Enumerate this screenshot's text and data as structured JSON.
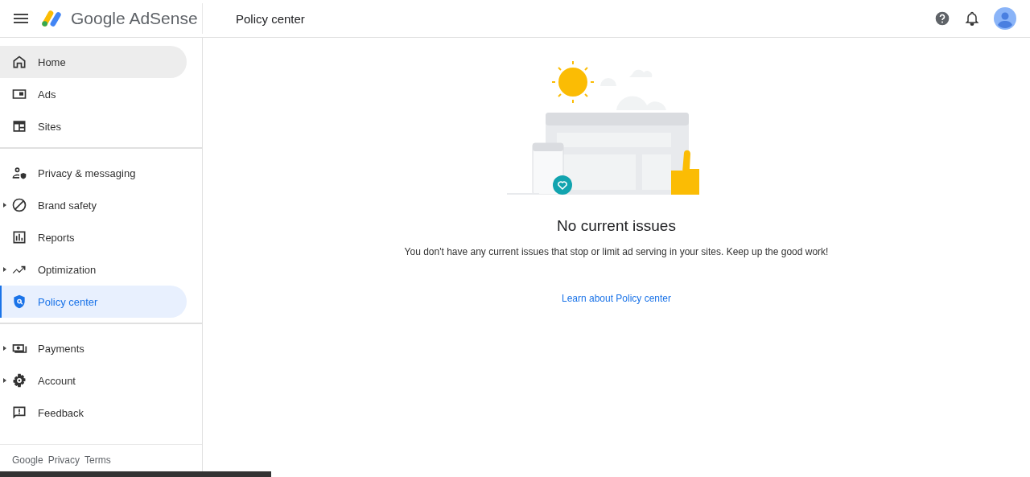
{
  "header": {
    "product": "Google AdSense",
    "page_title": "Policy center"
  },
  "sidebar": {
    "sections": [
      [
        {
          "label": "Home",
          "expandable": false,
          "selected": false,
          "hovered": true
        },
        {
          "label": "Ads",
          "expandable": false,
          "selected": false,
          "hovered": false
        },
        {
          "label": "Sites",
          "expandable": false,
          "selected": false,
          "hovered": false
        }
      ],
      [
        {
          "label": "Privacy & messaging",
          "expandable": false,
          "selected": false,
          "hovered": false
        },
        {
          "label": "Brand safety",
          "expandable": true,
          "selected": false,
          "hovered": false
        },
        {
          "label": "Reports",
          "expandable": false,
          "selected": false,
          "hovered": false
        },
        {
          "label": "Optimization",
          "expandable": true,
          "selected": false,
          "hovered": false
        },
        {
          "label": "Policy center",
          "expandable": false,
          "selected": true,
          "hovered": false
        }
      ],
      [
        {
          "label": "Payments",
          "expandable": true,
          "selected": false,
          "hovered": false
        },
        {
          "label": "Account",
          "expandable": true,
          "selected": false,
          "hovered": false
        },
        {
          "label": "Feedback",
          "expandable": false,
          "selected": false,
          "hovered": false
        }
      ]
    ],
    "footer_links": [
      "Google",
      "Privacy",
      "Terms"
    ]
  },
  "main": {
    "heading": "No current issues",
    "message": "You don't have any current issues that stop or limit ad serving in your sites. Keep up the good work!",
    "link": "Learn about Policy center"
  }
}
